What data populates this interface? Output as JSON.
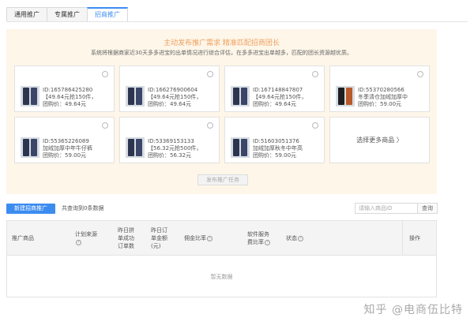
{
  "tabs": [
    {
      "label": "通用推广",
      "active": false
    },
    {
      "label": "专属推广",
      "active": false
    },
    {
      "label": "招商推广",
      "active": true
    }
  ],
  "banner": {
    "title": "主动发布推广需求 精准匹配招商团长",
    "subtitle": "系统将根据商家近30天多多进宝的出单情况进行综合评估，在多多进宝出单越多，匹配的团长资源越优质。"
  },
  "products": [
    {
      "id": "ID:165786425280",
      "name": "【49.64元抢150件，",
      "price": "团购价：49.64元"
    },
    {
      "id": "ID:166276900604",
      "name": "【49.64元抢150件，",
      "price": "团购价：49.64元"
    },
    {
      "id": "ID:167148847807",
      "name": "【49.64元抢150件，",
      "price": "团购价：49.64元"
    },
    {
      "id": "ID:55370280566",
      "name": "冬季清仓加绒加厚中",
      "price": "团购价：59.00元"
    },
    {
      "id": "ID:55365226089",
      "name": "加绒加厚中年牛仔裤",
      "price": "团购价：59.00元"
    },
    {
      "id": "ID:53369153133",
      "name": "【56.32元抢500件，",
      "price": "团购价：56.32元"
    },
    {
      "id": "ID:51603051376",
      "name": "加绒加厚秋冬中年高",
      "price": "团购价：59.00元"
    }
  ],
  "more_products": "选择更多商品 〉",
  "publish_button": "发布推广任务",
  "toolbar": {
    "new_button": "新建招商推广",
    "query_count": "共查询到0条数据",
    "search_placeholder": "请输入商品ID",
    "search_button": "查询"
  },
  "table": {
    "headers": {
      "product": "推广商品",
      "plan_source": "计划来源",
      "orders_line1": "昨日拼",
      "orders_line2": "单成功",
      "orders_line3": "订单数",
      "amount_line1": "昨日订",
      "amount_line2": "单金额",
      "amount_line3": "(元)",
      "commission": "佣金比率",
      "service_line1": "软件服务",
      "service_line2": "费比率",
      "status": "状态",
      "action": "操作"
    },
    "empty_text": "暂无数据"
  },
  "watermark": "知乎 @电商伍比特"
}
